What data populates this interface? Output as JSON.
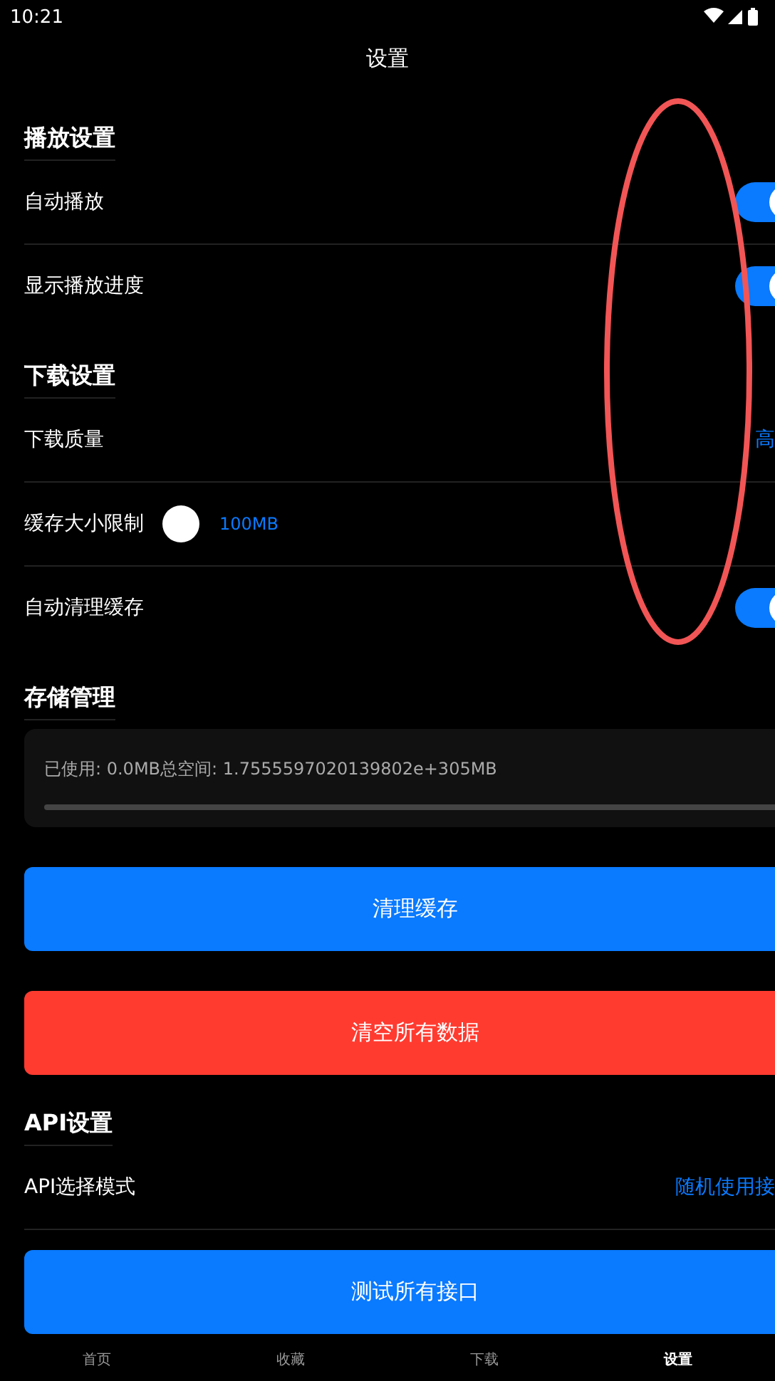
{
  "status_bar": {
    "time": "10:21"
  },
  "title": "设置",
  "sections": [
    {
      "title": "播放设置",
      "rows": [
        {
          "kind": "toggle",
          "label": "自动播放",
          "on": true
        },
        {
          "kind": "toggle",
          "label": "显示播放进度",
          "on": true
        }
      ]
    },
    {
      "title": "下载设置",
      "rows": [
        {
          "kind": "value",
          "label": "下载质量",
          "value": "高"
        },
        {
          "kind": "slider",
          "label": "缓存大小限制",
          "reading": "100MB"
        },
        {
          "kind": "toggle",
          "label": "自动清理缓存",
          "on": true
        }
      ]
    },
    {
      "title": "存储管理",
      "storage": {
        "text": "已使用: 0.0MB总空间: 1.7555597020139802e+305MB"
      },
      "buttons": [
        {
          "label": "清理缓存",
          "kind": "primary"
        },
        {
          "label": "清空所有数据",
          "kind": "danger"
        }
      ]
    },
    {
      "title": "API设置",
      "rows": [
        {
          "kind": "value",
          "label": "API选择模式",
          "value": "随机使用接"
        }
      ],
      "buttons": [
        {
          "label": "测试所有接口",
          "kind": "primary"
        }
      ]
    }
  ],
  "nav": [
    {
      "label": "首页",
      "selected": false
    },
    {
      "label": "收藏",
      "selected": false
    },
    {
      "label": "下载",
      "selected": false
    },
    {
      "label": "设置",
      "selected": true
    }
  ]
}
